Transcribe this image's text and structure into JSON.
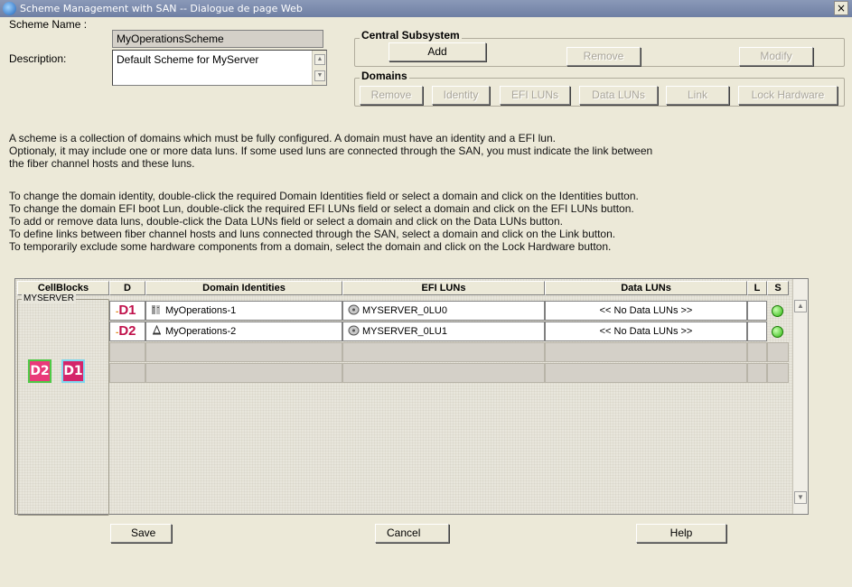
{
  "window": {
    "title": "Scheme Management with SAN -- Dialogue de page Web",
    "close_label": "×"
  },
  "form": {
    "scheme_name_label": "Scheme Name :",
    "scheme_name_value": "MyOperationsScheme",
    "description_label": "Description:",
    "description_value": "Default Scheme for MyServer"
  },
  "central_subsystem": {
    "title": "Central Subsystem",
    "buttons": [
      "Add",
      "Remove",
      "Modify"
    ]
  },
  "domains": {
    "title": "Domains",
    "buttons": [
      "Remove",
      "Identity",
      "EFI LUNs",
      "Data LUNs",
      "Link",
      "Lock Hardware"
    ]
  },
  "help": {
    "paragraph1": [
      "A scheme is a collection of domains which must be fully configured. A domain must have an identity and a EFI lun.",
      "Optionaly, it may include one or more data luns. If some used luns are connected through the SAN, you must indicate the link between",
      "the fiber channel hosts and these luns."
    ],
    "paragraph2": [
      "To change the domain identity, double-click the required Domain Identities field or select a domain and click on the Identities button.",
      "To change the domain EFI boot Lun, double-click the required EFI LUNs field or select a domain and click on the EFI LUNs button.",
      "To add or remove data luns, double-click the Data LUNs field or select a domain and click on the Data LUNs button.",
      "To define links between fiber channel hosts and luns connected through the SAN, select a domain and click on the Link button.",
      "To temporarily exclude some hardware components from a domain, select the domain and click on the Lock Hardware button."
    ]
  },
  "grid": {
    "headers": [
      "CellBlocks",
      "D",
      "Domain Identities",
      "EFI LUNs",
      "Data LUNs",
      "L",
      "S"
    ],
    "cellblock_group": "MYSERVER",
    "badges": [
      "D2",
      "D1"
    ],
    "rows": [
      {
        "d": "D1",
        "identity": "MyOperations-1",
        "efi": "MYSERVER_0LU0",
        "data": "<< No Data LUNs >>",
        "status": "green"
      },
      {
        "d": "D2",
        "identity": "MyOperations-2",
        "efi": "MYSERVER_0LU1",
        "data": "<< No Data LUNs >>",
        "status": "green"
      }
    ]
  },
  "footer": {
    "save": "Save",
    "cancel": "Cancel",
    "help": "Help"
  },
  "colors": {
    "dialog_bg": "#ece9d8",
    "status_ok": "#2fb80f",
    "domain_label": "#c0124c"
  }
}
